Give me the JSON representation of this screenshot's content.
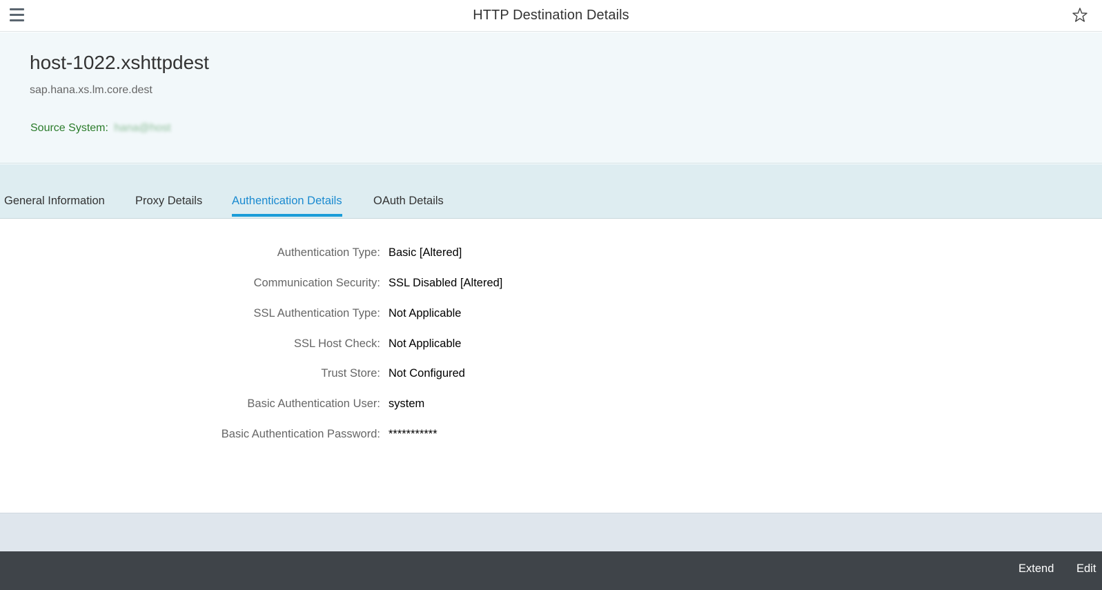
{
  "shell": {
    "title": "HTTP Destination Details"
  },
  "object": {
    "title": "host-1022.xshttpdest",
    "subtitle": "sap.hana.xs.lm.core.dest",
    "source_system_label": "Source System:",
    "source_system_value": "hana@host"
  },
  "tabs": [
    {
      "label": "General Information",
      "selected": false
    },
    {
      "label": "Proxy Details",
      "selected": false
    },
    {
      "label": "Authentication Details",
      "selected": true
    },
    {
      "label": "OAuth Details",
      "selected": false
    }
  ],
  "fields": [
    {
      "label": "Authentication Type:",
      "value": "Basic [Altered]"
    },
    {
      "label": "Communication Security:",
      "value": "SSL Disabled [Altered]"
    },
    {
      "label": "SSL Authentication Type:",
      "value": "Not Applicable"
    },
    {
      "label": "SSL Host Check:",
      "value": "Not Applicable"
    },
    {
      "label": "Trust Store:",
      "value": "Not Configured"
    },
    {
      "label": "Basic Authentication User:",
      "value": "system"
    },
    {
      "label": "Basic Authentication Password:",
      "value": "***********"
    }
  ],
  "footer": {
    "extend_label": "Extend",
    "edit_label": "Edit"
  },
  "colors": {
    "accent": "#1a9cd8",
    "source_system": "#2b7c2b",
    "footer_bg": "#3f4449"
  },
  "icons": {
    "menu": "menu-icon",
    "favorite": "star-icon"
  }
}
